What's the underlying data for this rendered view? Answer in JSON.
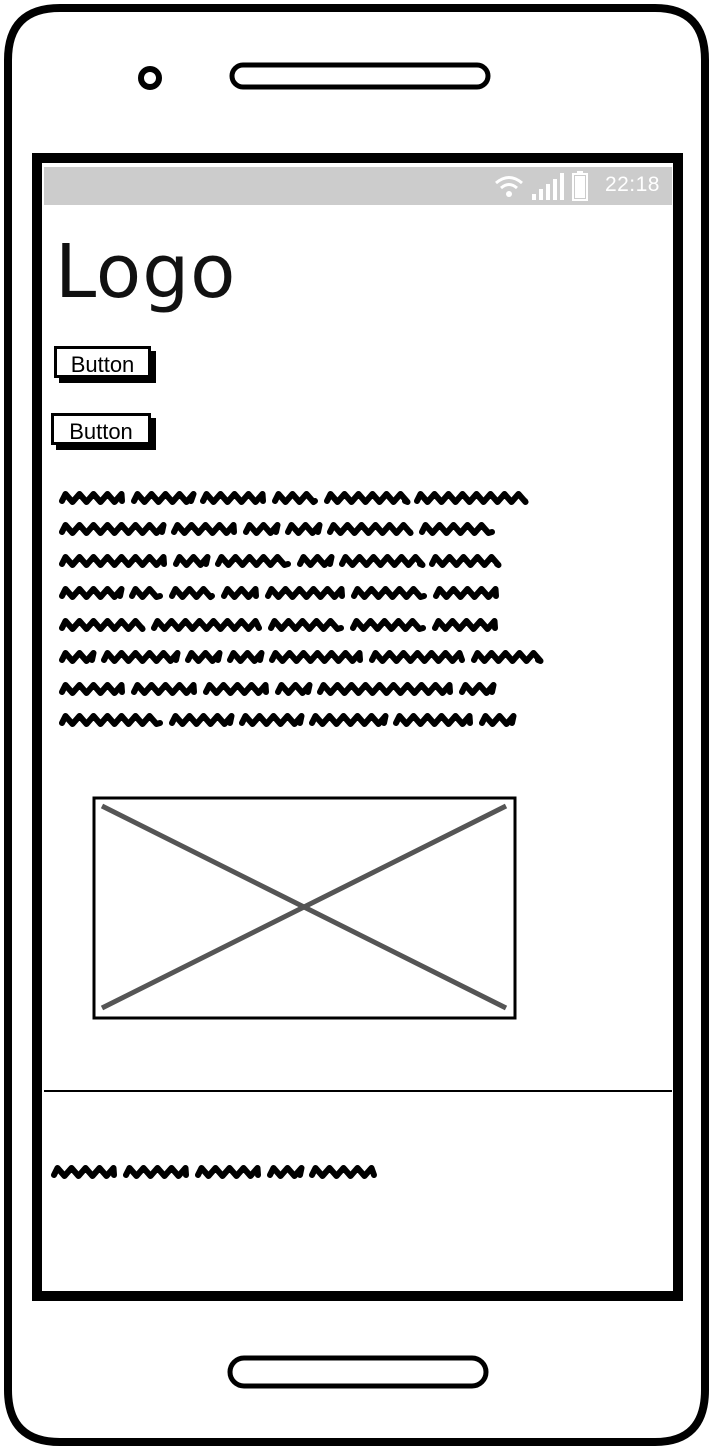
{
  "status_bar": {
    "time": "22:18",
    "icons": [
      "wifi-icon",
      "signal-icon",
      "battery-icon"
    ],
    "background": "#cccccc"
  },
  "header": {
    "logo_text": "Logo"
  },
  "buttons": [
    {
      "label": "Button"
    },
    {
      "label": "Button"
    }
  ],
  "image_placeholder": {
    "icon": "image-placeholder-icon"
  },
  "colors": {
    "frame": "#000000",
    "placeholder_cross": "#555555"
  }
}
